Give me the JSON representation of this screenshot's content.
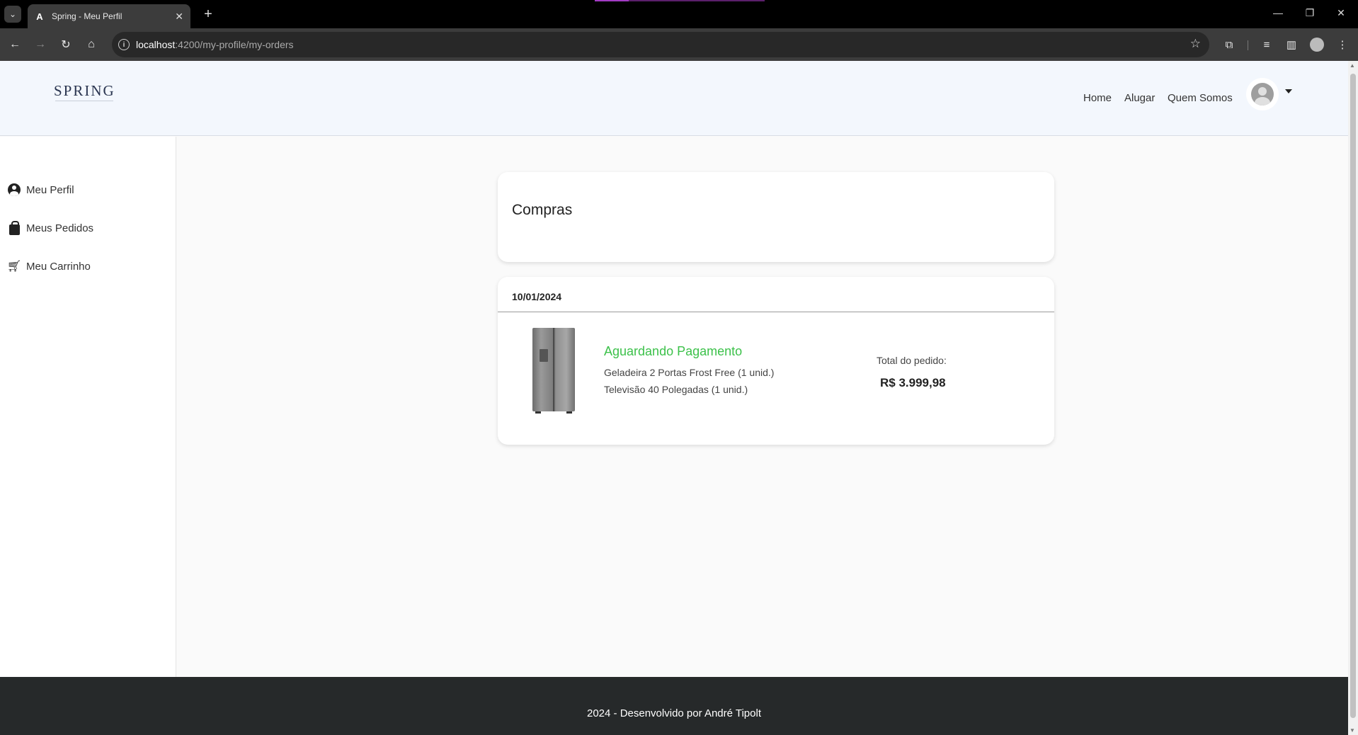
{
  "browser": {
    "tab_title": "Spring - Meu Perfil",
    "tab_favicon": "A",
    "url_host": "localhost",
    "url_path": ":4200/my-profile/my-orders"
  },
  "header": {
    "logo": "SPRING",
    "nav": [
      "Home",
      "Alugar",
      "Quem Somos"
    ]
  },
  "sidebar": {
    "items": [
      {
        "label": "Meu Perfil",
        "icon": "user-circle-icon"
      },
      {
        "label": "Meus Pedidos",
        "icon": "shopping-bag-icon"
      },
      {
        "label": "Meu Carrinho",
        "icon": "shopping-cart-icon"
      }
    ]
  },
  "main": {
    "title": "Compras",
    "orders": [
      {
        "date": "10/01/2024",
        "status": "Aguardando Pagamento",
        "status_color": "#3cc14a",
        "items": [
          "Geladeira 2 Portas Frost Free (1 unid.)",
          "Televisão 40 Polegadas (1 unid.)"
        ],
        "total_label": "Total do pedido:",
        "total_value": "R$ 3.999,98"
      }
    ]
  },
  "footer": {
    "text": "2024 - Desenvolvido por André Tipolt"
  }
}
